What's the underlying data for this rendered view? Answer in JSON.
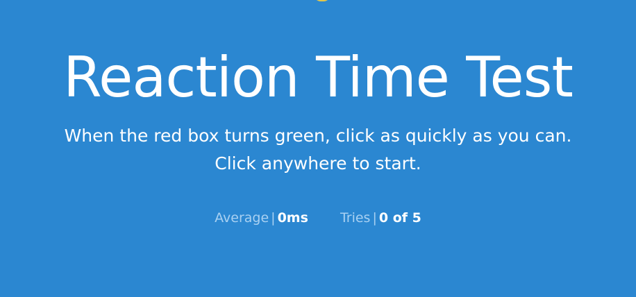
{
  "game": {
    "title": "Reaction Time Test",
    "instructions": [
      "When the red box turns green, click as quickly as you can.",
      "Click anywhere to start."
    ],
    "stats": {
      "average": {
        "label": "Average",
        "separator": "|",
        "value": "0ms"
      },
      "tries": {
        "label": "Tries",
        "separator": "|",
        "value": "0 of 5"
      }
    }
  },
  "colors": {
    "background": "#2b87d1",
    "text": "#ffffff",
    "muted_text": "#a9d1f2",
    "top_icon": "#e3c74a"
  }
}
